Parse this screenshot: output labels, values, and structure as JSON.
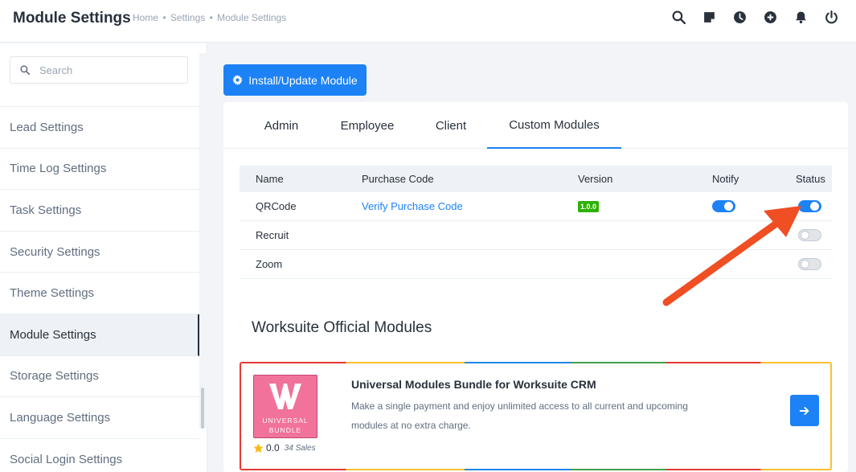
{
  "header": {
    "title": "Module Settings",
    "breadcrumb": [
      "Home",
      "Settings",
      "Module Settings"
    ],
    "icons": [
      "search-icon",
      "sticky-note-icon",
      "clock-icon",
      "plus-circle-icon",
      "bell-icon",
      "power-icon"
    ]
  },
  "sidebar": {
    "search_placeholder": "Search",
    "items": [
      {
        "label": "Lead Settings"
      },
      {
        "label": "Time Log Settings"
      },
      {
        "label": "Task Settings"
      },
      {
        "label": "Security Settings"
      },
      {
        "label": "Theme Settings"
      },
      {
        "label": "Module Settings",
        "active": true
      },
      {
        "label": "Storage Settings"
      },
      {
        "label": "Language Settings"
      },
      {
        "label": "Social Login Settings"
      }
    ]
  },
  "main": {
    "install_button": "Install/Update Module",
    "tabs": [
      {
        "label": "Admin"
      },
      {
        "label": "Employee"
      },
      {
        "label": "Client"
      },
      {
        "label": "Custom Modules",
        "active": true
      }
    ],
    "table": {
      "headers": [
        "Name",
        "Purchase Code",
        "Version",
        "Notify",
        "Status"
      ],
      "rows": [
        {
          "name": "QRCode",
          "purchase_code": "Verify Purchase Code",
          "version": "1.0.0",
          "notify": true,
          "status": true
        },
        {
          "name": "Recruit",
          "purchase_code": "",
          "version": "",
          "notify": null,
          "status": false
        },
        {
          "name": "Zoom",
          "purchase_code": "",
          "version": "",
          "notify": null,
          "status": false
        }
      ]
    },
    "official_title": "Worksuite Official Modules",
    "bundle": {
      "logo_line1": "UNIVERSAL",
      "logo_line2": "BUNDLE",
      "rating": "0.0",
      "sales": "34 Sales",
      "title": "Universal Modules Bundle for Worksuite CRM",
      "description": "Make a single payment and enjoy unlimited access to all current and upcoming modules at no extra charge."
    }
  },
  "colors": {
    "primary": "#1d82f5",
    "badge": "#2cb100",
    "arrow": "#f04e23",
    "logo_bg": "#f1729a"
  }
}
